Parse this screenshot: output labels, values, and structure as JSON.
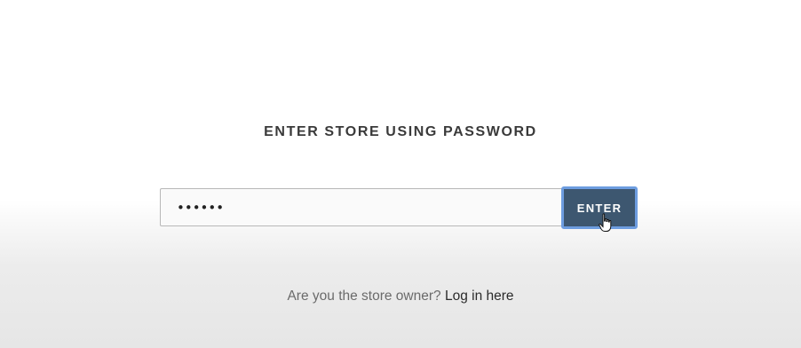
{
  "heading": "ENTER STORE USING PASSWORD",
  "password": {
    "value": "••••••",
    "type": "password"
  },
  "enter_button": {
    "label": "ENTER"
  },
  "owner_prompt": {
    "text": "Are you the store owner?",
    "link_label": "Log in here"
  },
  "colors": {
    "button_bg": "#3d5770",
    "button_focus_ring": "#6d9de0",
    "heading_text": "#3a3a3a",
    "muted_text": "#6b6b6b"
  },
  "icons": {
    "cursor": "hand-pointer-icon"
  }
}
